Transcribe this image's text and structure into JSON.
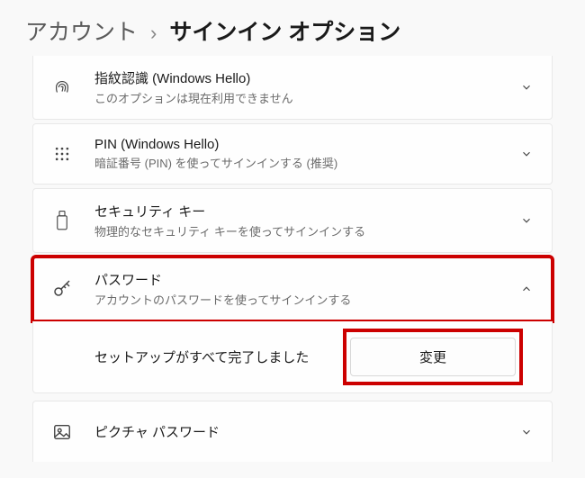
{
  "breadcrumb": {
    "parent": "アカウント",
    "separator": "›",
    "current": "サインイン オプション"
  },
  "options": {
    "fingerprint": {
      "title": "指紋認識 (Windows Hello)",
      "desc": "このオプションは現在利用できません"
    },
    "pin": {
      "title": "PIN (Windows Hello)",
      "desc": "暗証番号 (PIN) を使ってサインインする (推奨)"
    },
    "security_key": {
      "title": "セキュリティ キー",
      "desc": "物理的なセキュリティ キーを使ってサインインする"
    },
    "password": {
      "title": "パスワード",
      "desc": "アカウントのパスワードを使ってサインインする",
      "status": "セットアップがすべて完了しました",
      "change_label": "変更"
    },
    "picture": {
      "title": "ピクチャ パスワード"
    }
  }
}
